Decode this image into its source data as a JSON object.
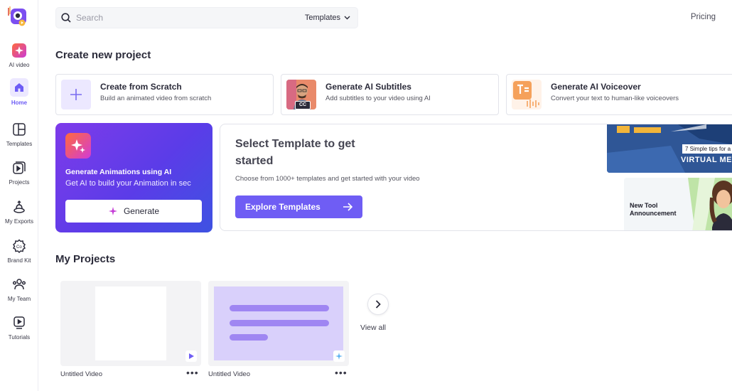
{
  "search": {
    "placeholder": "Search",
    "category": "Templates"
  },
  "header": {
    "pricing": "Pricing"
  },
  "sidebar": {
    "items": [
      {
        "label": "AI video",
        "icon": "sparkle-icon"
      },
      {
        "label": "Home",
        "icon": "home-icon",
        "active": true
      },
      {
        "label": "Templates",
        "icon": "templates-icon"
      },
      {
        "label": "Projects",
        "icon": "projects-icon"
      },
      {
        "label": "My Exports",
        "icon": "exports-icon"
      },
      {
        "label": "Brand Kit",
        "icon": "brand-kit-icon"
      },
      {
        "label": "My Team",
        "icon": "team-icon"
      },
      {
        "label": "Tutorials",
        "icon": "tutorials-icon"
      }
    ]
  },
  "create": {
    "heading": "Create new project",
    "cards": [
      {
        "title": "Create from Scratch",
        "subtitle": "Build an animated video from scratch"
      },
      {
        "title": "Generate AI Subtitles",
        "subtitle": "Add subtitles to your video using AI",
        "badge": "CC"
      },
      {
        "title": "Generate AI Voiceover",
        "subtitle": "Convert your text to human-like voiceovers"
      }
    ]
  },
  "ai_card": {
    "title": "Generate Animations using AI",
    "subtitle": "Get AI to build your Animation in sec",
    "button": "Generate"
  },
  "templates": {
    "title": "Select Template to get started",
    "subtitle": "Choose from 1000+ templates and get started with your video",
    "button": "Explore Templates",
    "thumb1_line1": "7 Simple tips for a",
    "thumb1_line2": "VIRTUAL ME",
    "thumb2_line1": "New Tool",
    "thumb2_line2": "Announcement"
  },
  "projects": {
    "heading": "My Projects",
    "items": [
      {
        "name": "Untitled Video"
      },
      {
        "name": "Untitled Video"
      }
    ],
    "view_all": "View all"
  },
  "colors": {
    "accent": "#6f5df4",
    "ai_gradient_start": "#7e3bea",
    "ai_gradient_end": "#3e52e2"
  }
}
